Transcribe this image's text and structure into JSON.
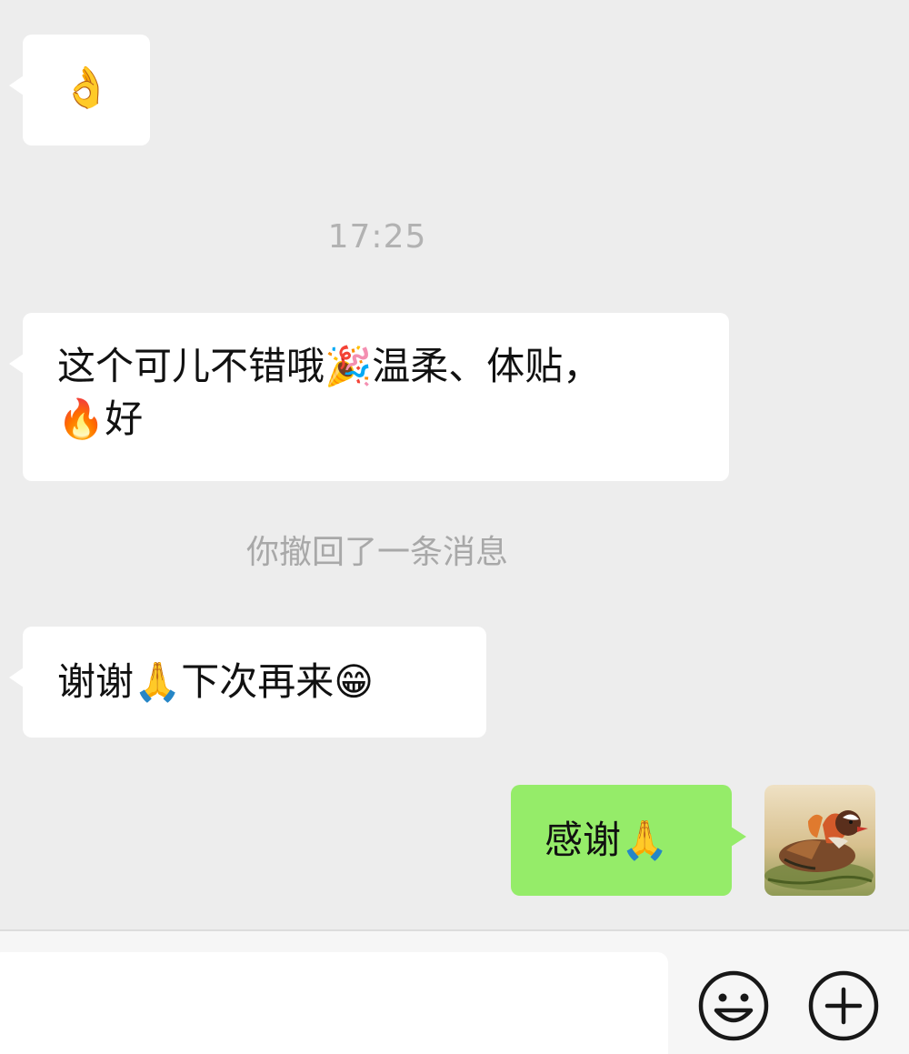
{
  "messages": {
    "first_emoji": "👌",
    "timestamp": "17:25",
    "msg_praise_line1": "这个可儿不错哦🎉温柔、体贴，",
    "msg_praise_line2": "🔥好",
    "recall_notice": "你撤回了一条消息",
    "msg_thanks": "谢谢🙏下次再来😁",
    "reply": "感谢🙏"
  },
  "input_bar": {
    "input_value": "",
    "emoji_icon": "smiley-icon",
    "more_icon": "plus-circle-icon"
  },
  "colors": {
    "background": "#ededed",
    "incoming_bubble": "#ffffff",
    "outgoing_bubble": "#95ec69",
    "meta_text": "#b2b2b2"
  }
}
